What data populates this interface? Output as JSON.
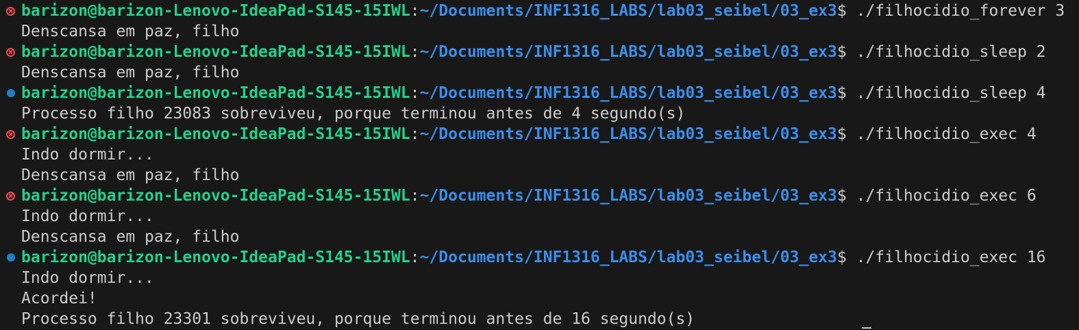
{
  "terminal": {
    "prompt_user": "barizon@barizon-Lenovo-IdeaPad-S145-15IWL",
    "prompt_sep": ":",
    "prompt_path": "~/Documents/INF1316_LABS/lab03_seibel/03_ex3",
    "prompt_symbol": "$ ",
    "blocks": [
      {
        "status": "error",
        "status_icon": "error-circle-icon",
        "command": "./filhocidio_forever 3",
        "output": [
          "Denscansa em paz, filho"
        ]
      },
      {
        "status": "error",
        "status_icon": "error-circle-icon",
        "command": "./filhocidio_sleep 2",
        "output": [
          "Denscansa em paz, filho"
        ]
      },
      {
        "status": "success",
        "status_icon": "success-dot-icon",
        "command": "./filhocidio_sleep 4",
        "output": [
          "Processo filho 23083 sobreviveu, porque terminou antes de 4 segundo(s)"
        ]
      },
      {
        "status": "error",
        "status_icon": "error-circle-icon",
        "command": "./filhocidio_exec 4",
        "output": [
          "Indo dormir...",
          "Denscansa em paz, filho"
        ]
      },
      {
        "status": "error",
        "status_icon": "error-circle-icon",
        "command": "./filhocidio_exec 6",
        "output": [
          "Indo dormir...",
          "Denscansa em paz, filho"
        ]
      },
      {
        "status": "success",
        "status_icon": "success-dot-icon",
        "command": "./filhocidio_exec 16",
        "output": [
          "Indo dormir...",
          "Acordei!",
          "Processo filho 23301 sobreviveu, porque terminou antes de 16 segundo(s)"
        ]
      }
    ]
  },
  "colors": {
    "background": "#181818",
    "user": "#23d18b",
    "path": "#3b8eea",
    "text": "#cccccc",
    "error_decoration": "#f14c4c",
    "success_decoration": "#1b81c9"
  }
}
